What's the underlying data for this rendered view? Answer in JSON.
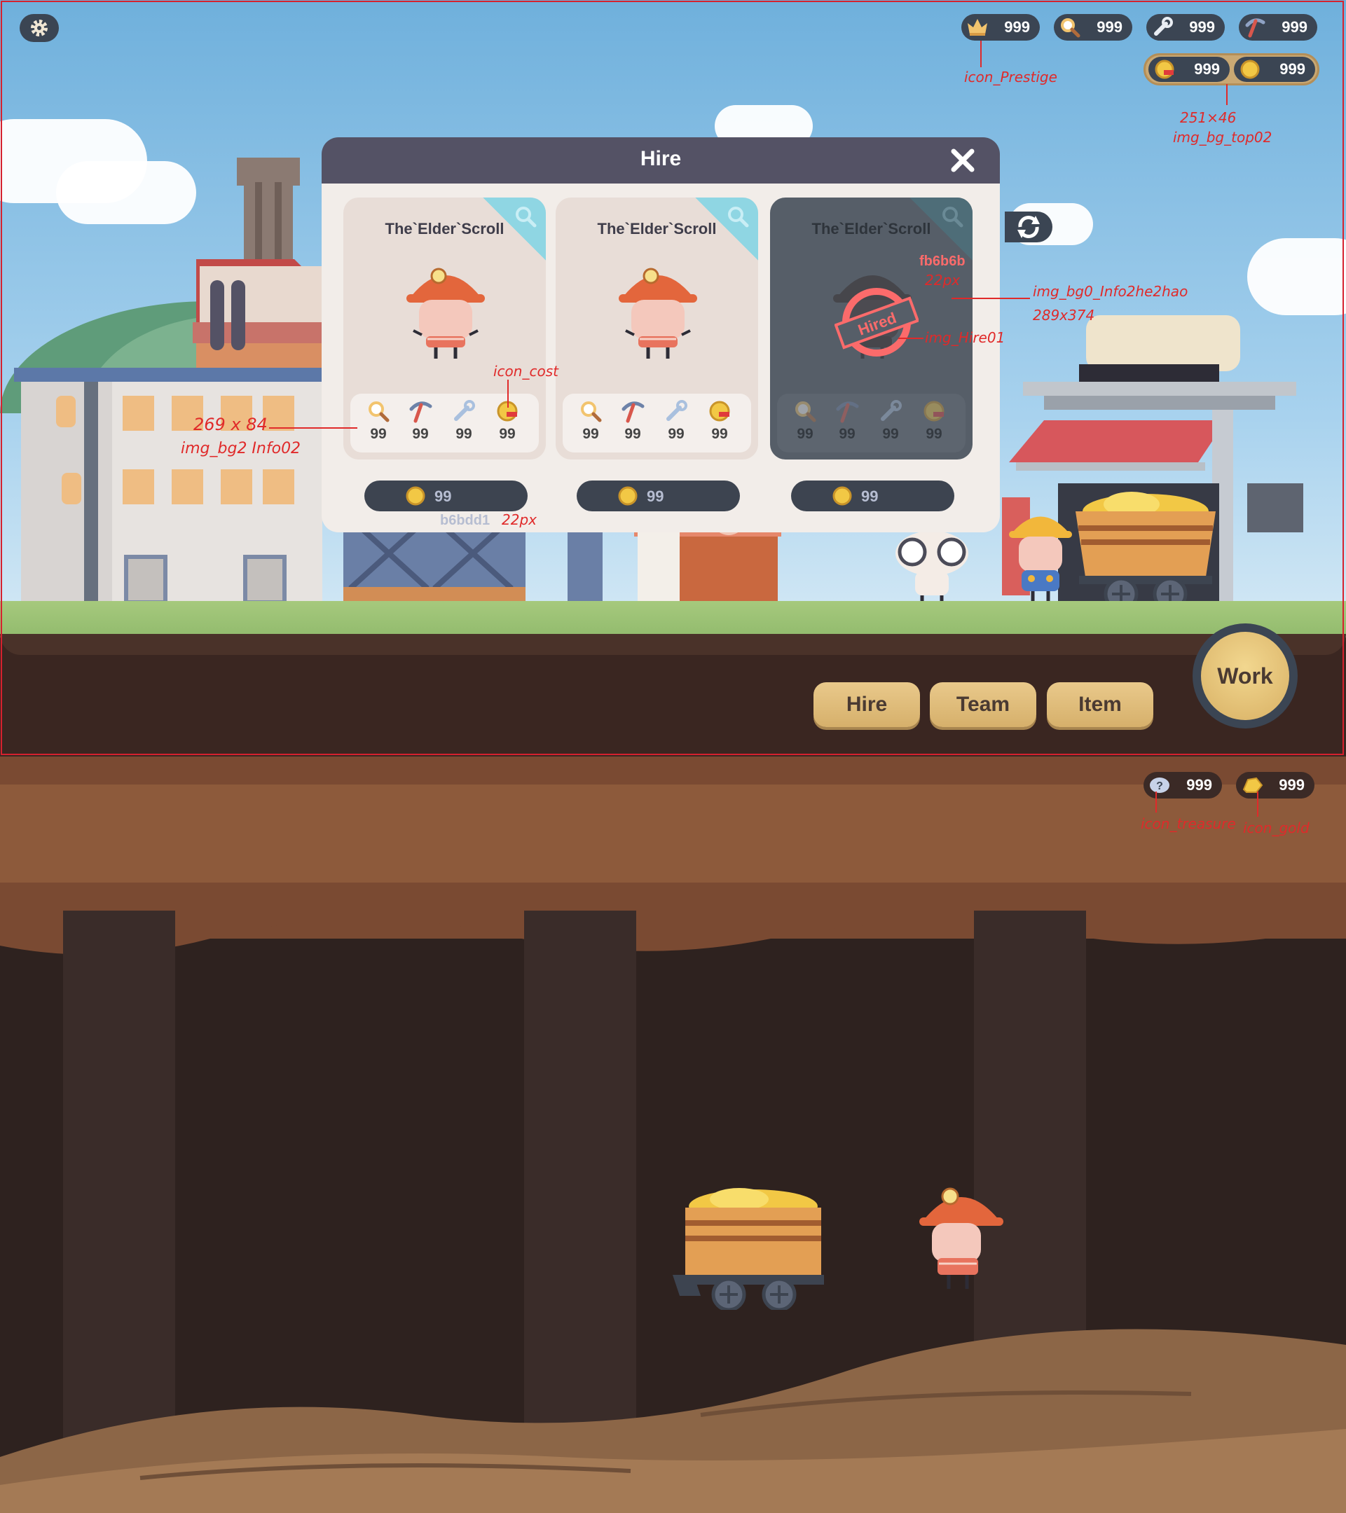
{
  "top_hud": {
    "resources": [
      {
        "icon": "crown-icon",
        "value": "999"
      },
      {
        "icon": "magnifier-icon",
        "value": "999"
      },
      {
        "icon": "wrench-icon",
        "value": "999"
      },
      {
        "icon": "pickaxe-icon",
        "value": "999"
      }
    ],
    "gold_bar": [
      {
        "icon": "coin-cost-icon",
        "value": "999"
      },
      {
        "icon": "coin-icon",
        "value": "999"
      }
    ]
  },
  "annotations": {
    "prestige": "icon_Prestige",
    "top_bar_size": "251×46",
    "top_bar_name": "img_bg_top02",
    "card_info_size": "269 x 84",
    "card_info_name": "img_bg2 Info02",
    "icon_cost": "icon_cost",
    "hired_color": "fb6b6b",
    "hired_size": "22px",
    "card_bg_name": "img_bg0_Info2he2hao",
    "card_bg_size": "289x374",
    "hired_img": "img_Hire01",
    "cost_color": "b6bdd1",
    "cost_size": "22px",
    "treasure": "icon_treasure",
    "gold": "icon_gold"
  },
  "dialog": {
    "title": "Hire",
    "cards": [
      {
        "name": "The`Elder`Scroll",
        "hired": false,
        "stats": [
          "99",
          "99",
          "99",
          "99"
        ],
        "cost": "99"
      },
      {
        "name": "The`Elder`Scroll",
        "hired": false,
        "stats": [
          "99",
          "99",
          "99",
          "99"
        ],
        "cost": "99"
      },
      {
        "name": "The`Elder`Scroll",
        "hired": true,
        "stamp": "Hired",
        "stats": [
          "99",
          "99",
          "99",
          "99"
        ],
        "cost": "99"
      }
    ]
  },
  "actions": {
    "hire": "Hire",
    "team": "Team",
    "item": "Item",
    "work": "Work"
  },
  "bottom_hud": [
    {
      "icon": "treasure-icon",
      "value": "999"
    },
    {
      "icon": "gold-nugget-icon",
      "value": "999"
    }
  ],
  "colors": {
    "panel": "#3b4553",
    "header": "#545265",
    "button": "#d6b06b",
    "hired_text": "#fb6b6b",
    "cost_text": "#b6bdd1"
  }
}
